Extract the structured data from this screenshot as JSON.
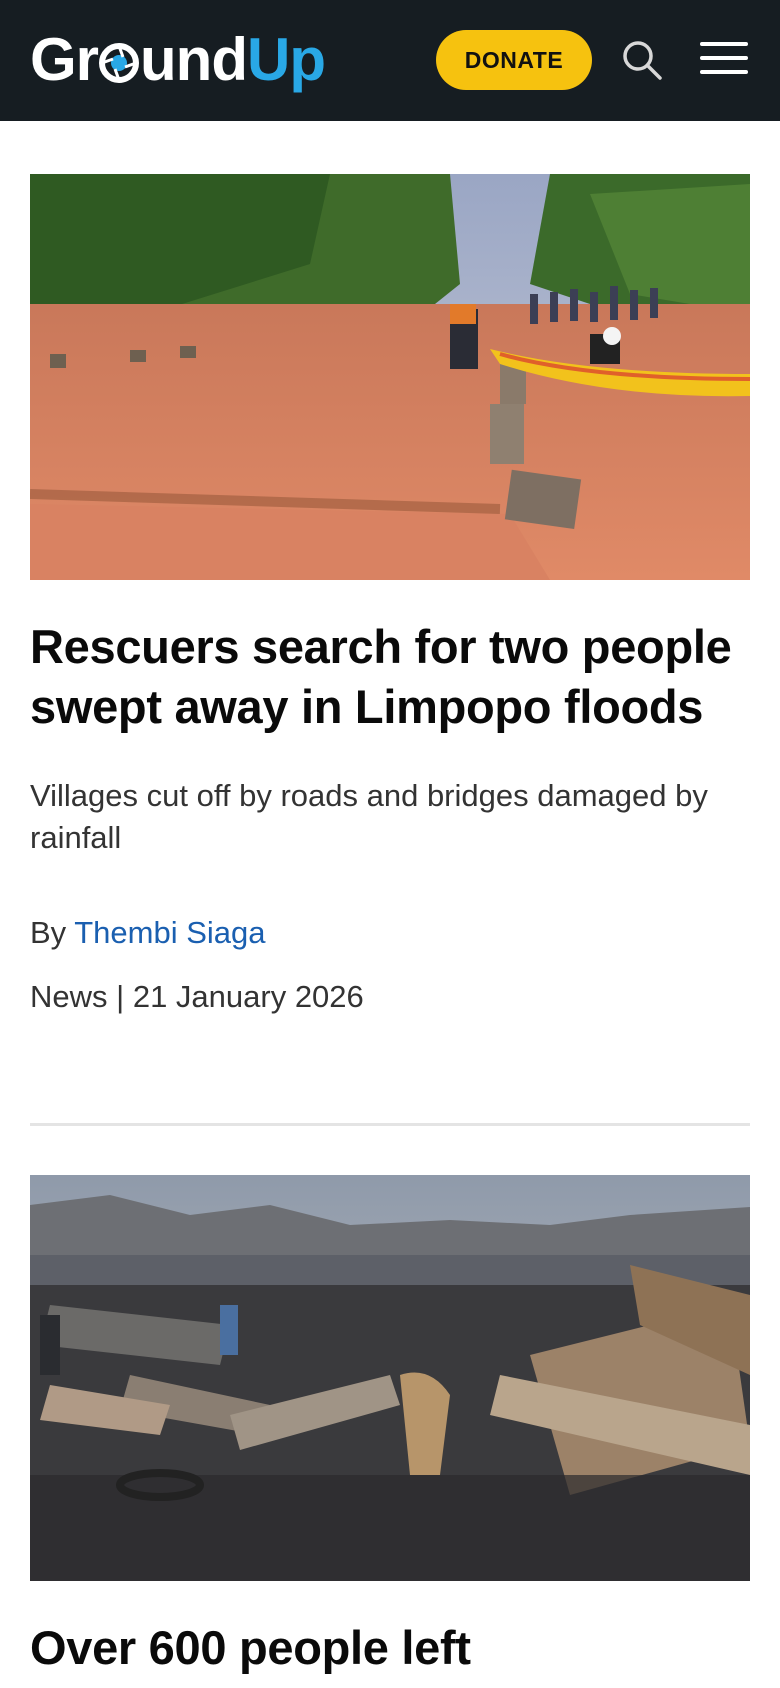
{
  "header": {
    "logo_part1": "Gr",
    "logo_part2": "und",
    "logo_part3": "Up",
    "donate_label": "DONATE",
    "search_icon": "search-icon",
    "menu_icon": "hamburger-menu-icon",
    "colors": {
      "bar": "#161d22",
      "brand_blue": "#29a8e6",
      "donate": "#f6c20f"
    }
  },
  "articles": [
    {
      "image": "flood-rescue-photo",
      "headline": "Rescuers search for two people swept away in Limpopo floods",
      "dek": "Villages cut off by roads and bridges damaged by rainfall",
      "by_prefix": "By",
      "author": "Thembi Siaga",
      "category": "News",
      "separator": "|",
      "date": "21 January 2026"
    },
    {
      "image": "burned-settlement-photo",
      "headline": "Over 600 people left"
    }
  ],
  "link_color": "#1a5fb0"
}
